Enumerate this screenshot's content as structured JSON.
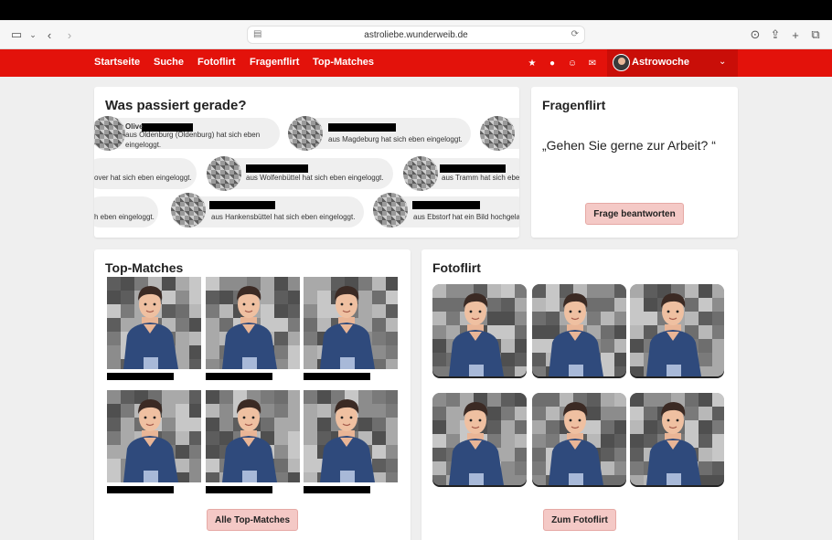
{
  "browser": {
    "url": "astroliebe.wunderweib.de"
  },
  "nav": {
    "links": [
      "Startseite",
      "Suche",
      "Fotoflirt",
      "Fragenflirt",
      "Top-Matches"
    ],
    "icons": [
      "star-icon",
      "user-icon",
      "smiley-icon",
      "mail-icon"
    ],
    "profile_name": "Astrowoche"
  },
  "activity": {
    "title": "Was passiert gerade?",
    "rows": [
      [
        {
          "name": "Olive",
          "text": "aus Oldenburg (Oldenburg) hat sich eben eingeloggt."
        },
        {
          "name": "",
          "text": "aus Magdeburg hat sich eben eingeloggt."
        },
        {
          "name": "",
          "text": ""
        }
      ],
      [
        {
          "name": "",
          "text": "over hat sich eben eingeloggt."
        },
        {
          "name": "",
          "text": "aus Wolfenbüttel hat sich eben eingeloggt."
        },
        {
          "name": "",
          "text": "aus Tramm hat sich ebe"
        }
      ],
      [
        {
          "name": "",
          "text": "h eben eingeloggt."
        },
        {
          "name": "",
          "text": "aus Hankensbüttel hat sich eben eingeloggt."
        },
        {
          "name": "",
          "text": "aus Ebstorf hat ein Bild hochgela"
        }
      ]
    ]
  },
  "fragenflirt": {
    "title": "Fragenflirt",
    "question": "„Gehen Sie gerne zur Arbeit? “",
    "button": "Frage beantworten"
  },
  "topmatches": {
    "title": "Top-Matches",
    "button": "Alle Top-Matches"
  },
  "fotoflirt": {
    "title": "Fotoflirt",
    "button": "Zum Fotoflirt"
  },
  "colors": {
    "brand_red": "#e3120b",
    "button_pink": "#f4c9c6"
  }
}
